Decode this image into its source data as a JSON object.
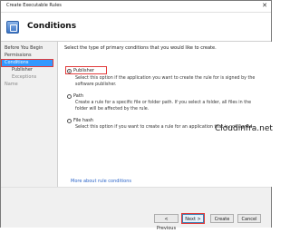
{
  "window": {
    "title": "Create Executable Rules",
    "close_glyph": "✕"
  },
  "header": {
    "title": "Conditions",
    "icon": "rules-wizard-icon"
  },
  "sidebar": {
    "items": [
      {
        "label": "Before You Begin"
      },
      {
        "label": "Permissions"
      },
      {
        "label": "Conditions"
      },
      {
        "label": "Publisher"
      },
      {
        "label": "Exceptions"
      },
      {
        "label": "Name"
      }
    ]
  },
  "content": {
    "intro": "Select the type of primary conditions that you would like to create.",
    "options": [
      {
        "label": "Publisher",
        "selected": true,
        "description": "Select this option if the application you want to create the rule for is signed by the software publisher."
      },
      {
        "label": "Path",
        "selected": false,
        "description": "Create a rule for a specific file or folder path. If you select a folder, all files in the folder will be affected by the rule."
      },
      {
        "label": "File hash",
        "selected": false,
        "description": "Select this option if you want to create a rule for an application that is not signed."
      }
    ],
    "link": "More about rule conditions"
  },
  "watermark": "Cloudinfra.net",
  "footer": {
    "previous": "< Previous",
    "next": "Next >",
    "create": "Create",
    "cancel": "Cancel"
  },
  "accent": "#3399ff",
  "highlight": "#e23a3a"
}
